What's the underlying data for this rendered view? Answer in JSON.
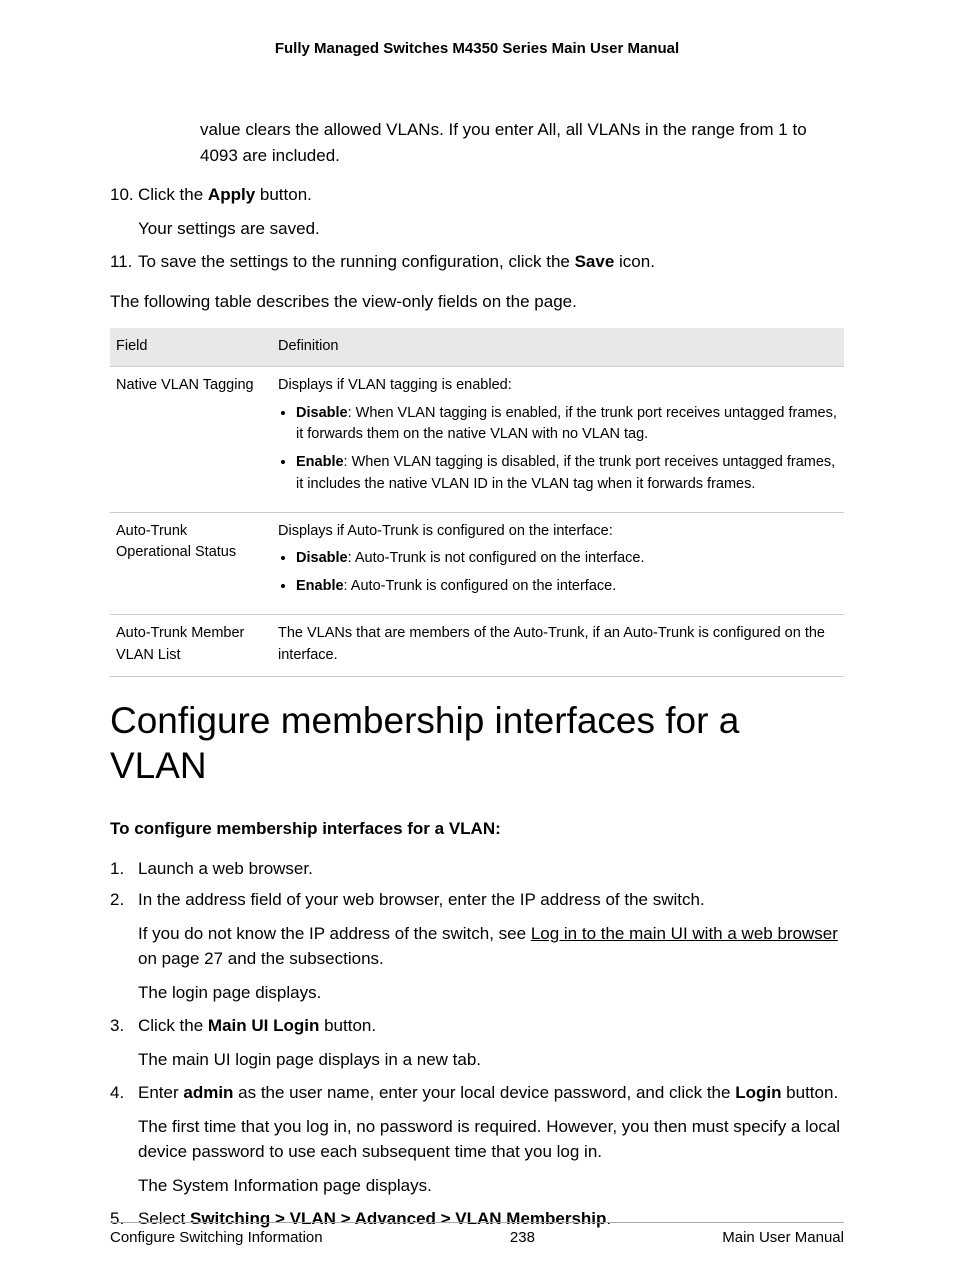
{
  "header": {
    "title": "Fully Managed Switches M4350 Series Main User Manual"
  },
  "intro": {
    "hang_text": "value clears the allowed VLANs. If you enter All, all VLANs in the range from 1 to 4093 are included."
  },
  "steps_top": {
    "s10_num": "10.",
    "s10_a": "Click the ",
    "s10_b": "Apply",
    "s10_c": " button.",
    "s10_follow": "Your settings are saved.",
    "s11_num": "11.",
    "s11_a": "To save the settings to the running configuration, click the ",
    "s11_b": "Save",
    "s11_c": " icon."
  },
  "table_intro": "The following table describes the view-only fields on the page.",
  "table": {
    "h_field": "Field",
    "h_def": "Definition",
    "r1_field": "Native VLAN Tagging",
    "r1_intro": "Displays if VLAN tagging is enabled:",
    "r1_b1_b": "Disable",
    "r1_b1_t": ": When VLAN tagging is enabled, if the trunk port receives untagged frames, it forwards them on the native VLAN with no VLAN tag.",
    "r1_b2_b": "Enable",
    "r1_b2_t": ": When VLAN tagging is disabled, if the trunk port receives untagged frames, it includes the native VLAN ID in the VLAN tag when it forwards frames.",
    "r2_field": "Auto-Trunk Operational Status",
    "r2_intro": "Displays if Auto-Trunk is configured on the interface:",
    "r2_b1_b": "Disable",
    "r2_b1_t": ": Auto-Trunk is not configured on the interface.",
    "r2_b2_b": "Enable",
    "r2_b2_t": ": Auto-Trunk is configured on the interface.",
    "r3_field": "Auto-Trunk Member VLAN List",
    "r3_def": "The VLANs that are members of the Auto-Trunk, if an Auto-Trunk is configured on the interface."
  },
  "section_heading": "Configure membership interfaces for a VLAN",
  "sub_heading": "To configure membership interfaces for a VLAN:",
  "steps_proc": {
    "s1_num": "1.",
    "s1": "Launch a web browser.",
    "s2_num": "2.",
    "s2": "In the address field of your web browser, enter the IP address of the switch.",
    "s2_f1_a": "If you do not know the IP address of the switch, see ",
    "s2_f1_link": "Log in to the main UI with a web browser",
    "s2_f1_b": " on page 27 and the subsections.",
    "s2_f2": "The login page displays.",
    "s3_num": "3.",
    "s3_a": "Click the ",
    "s3_b": "Main UI Login",
    "s3_c": " button.",
    "s3_f": "The main UI login page displays in a new tab.",
    "s4_num": "4.",
    "s4_a": "Enter ",
    "s4_b": "admin",
    "s4_c": " as the user name, enter your local device password, and click the ",
    "s4_d": "Login",
    "s4_e": " button.",
    "s4_f1": "The first time that you log in, no password is required. However, you then must specify a local device password to use each subsequent time that you log in.",
    "s4_f2": "The System Information page displays.",
    "s5_num": "5.",
    "s5_a": "Select ",
    "s5_b": "Switching > VLAN > Advanced > VLAN Membership",
    "s5_c": "."
  },
  "footer": {
    "left": "Configure Switching Information",
    "center": "238",
    "right": "Main User Manual"
  }
}
